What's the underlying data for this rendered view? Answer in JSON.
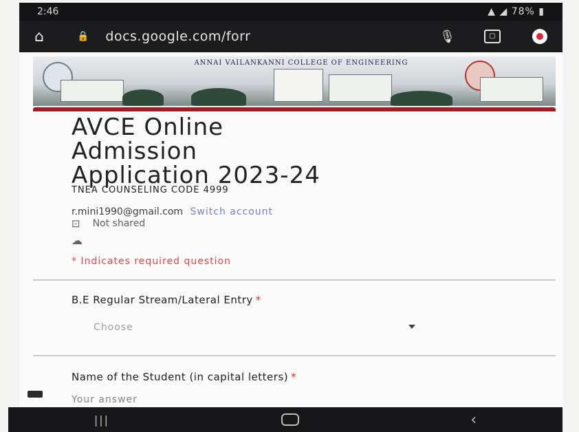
{
  "status_bar": {
    "time": "2:46",
    "battery": "78%"
  },
  "browser": {
    "url": "docs.google.com/forr"
  },
  "header": {
    "college_name": "ANNAI VAILANKANNI COLLEGE OF ENGINEERING",
    "accent_color": "#9e1f23"
  },
  "form": {
    "title": "AVCE Online\nAdmission\nApplication  2023-24",
    "code": "TNEA COUNSELING CODE 4999",
    "account_email": "r.mini1990@gmail.com",
    "switch_account": "Switch account",
    "not_shared": "Not shared",
    "required_note": "* Indicates required question"
  },
  "questions": [
    {
      "label": "B.E Regular Stream/Lateral Entry",
      "required_mark": "*",
      "placeholder": "Choose"
    },
    {
      "label": "Name of the Student (in capital letters)",
      "required_mark": "*",
      "placeholder": "Your answer"
    }
  ],
  "icons": {
    "home": "home-icon",
    "lock": "lock-icon",
    "mic": "mic-icon",
    "tabs": "tabs-icon",
    "record": "record-icon",
    "not_shared": "not-shared-icon",
    "cloud": "cloud-icon"
  }
}
